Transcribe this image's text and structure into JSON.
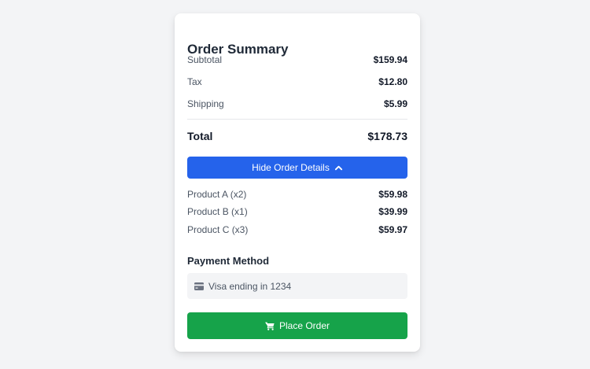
{
  "summary": {
    "title": "Order Summary",
    "subtotal_label": "Subtotal",
    "subtotal_value": "$159.94",
    "tax_label": "Tax",
    "tax_value": "$12.80",
    "shipping_label": "Shipping",
    "shipping_value": "$5.99",
    "total_label": "Total",
    "total_value": "$178.73"
  },
  "details": {
    "toggle_label": "Hide Order Details",
    "toggle_icon": "chevron-up-icon",
    "items": [
      {
        "label": "Product A (x2)",
        "price": "$59.98"
      },
      {
        "label": "Product B (x1)",
        "price": "$39.99"
      },
      {
        "label": "Product C (x3)",
        "price": "$59.97"
      }
    ]
  },
  "payment": {
    "title": "Payment Method",
    "icon": "credit-card-icon",
    "method": "Visa ending in 1234"
  },
  "actions": {
    "place_order_label": "Place Order",
    "place_order_icon": "cart-icon"
  },
  "colors": {
    "primary": "#2563eb",
    "success": "#16a34a",
    "background": "#f3f4f6",
    "card": "#ffffff"
  }
}
